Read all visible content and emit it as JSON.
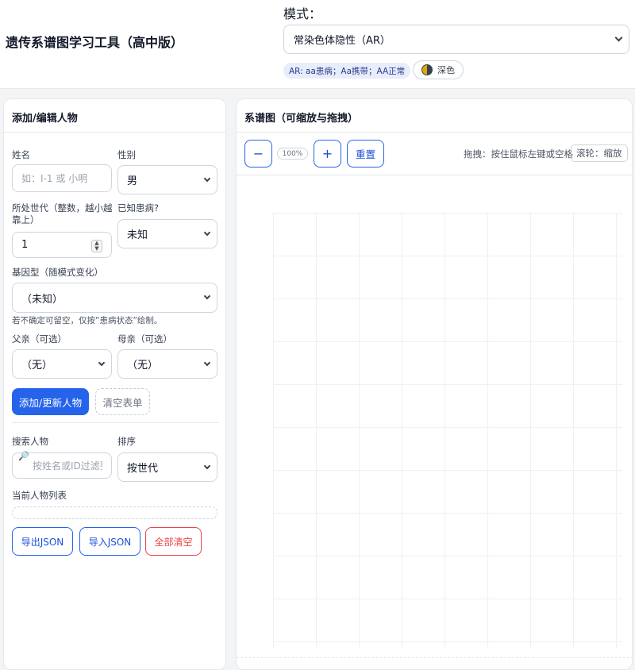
{
  "header": {
    "title": "遗传系谱图学习工具（高中版）",
    "mode_label": "模式：",
    "mode_value": "常染色体隐性（AR）",
    "hint": "AR: aa患病；Aa携带；AA正常",
    "theme_label": "深色"
  },
  "form": {
    "title": "添加/编辑人物",
    "name_label": "姓名",
    "name_placeholder": "如：I-1 或 小明",
    "sex_label": "性别",
    "sex_value": "男",
    "generation_label": "所处世代（整数，越小越靠上）",
    "generation_value": "1",
    "affected_label": "已知患病?",
    "affected_value": "未知",
    "genotype_label": "基因型（随模式变化）",
    "genotype_value": "（未知）",
    "genotype_note": "若不确定可留空，仅按“患病状态”绘制。",
    "father_label": "父亲（可选）",
    "father_value": "（无）",
    "mother_label": "母亲（可选）",
    "mother_value": "（无）",
    "add_button": "添加/更新人物",
    "clear_button": "清空表单",
    "search_label": "搜索人物",
    "search_placeholder": "按姓名或ID过滤列表",
    "sort_label": "排序",
    "sort_value": "按世代",
    "list_label": "当前人物列表",
    "export_button": "导出JSON",
    "import_button": "导入JSON",
    "clear_all_button": "全部清空"
  },
  "pedigree": {
    "title": "系谱图（可缩放与拖拽）",
    "zoom_out": "−",
    "zoom_level": "100%",
    "zoom_in": "+",
    "reset": "重置",
    "drag_hint": "拖拽：按住鼠标左键或空格",
    "wheel_hint": "滚轮：缩放"
  },
  "colors": {
    "accent": "#2563eb",
    "danger": "#ef4444",
    "hint_bg": "#e8edfb"
  }
}
